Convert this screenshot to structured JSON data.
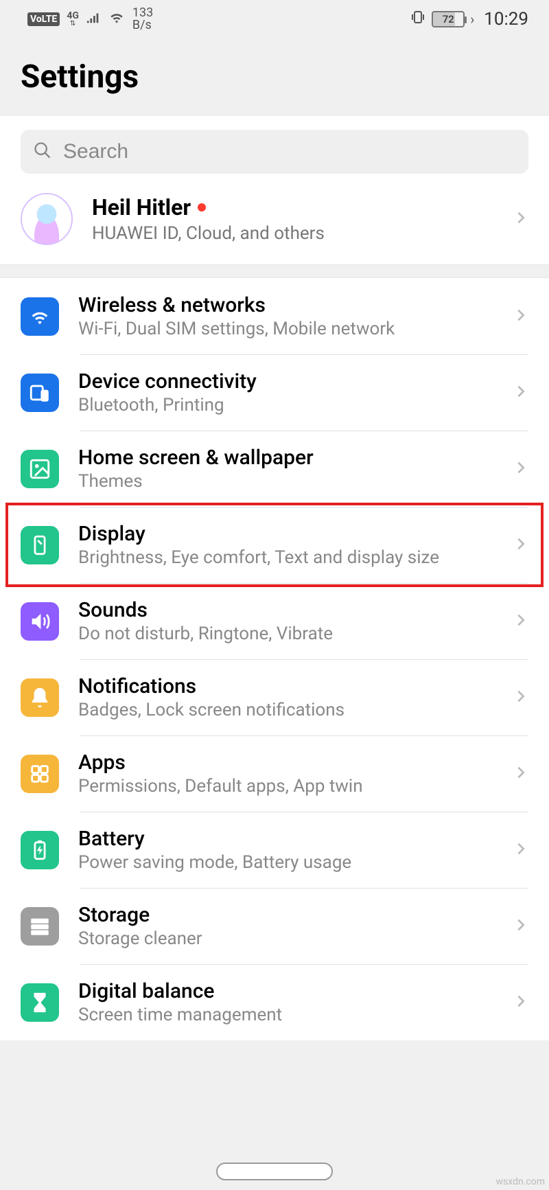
{
  "status": {
    "volte": "VoLTE",
    "network_gen": "4G",
    "speed_value": "133",
    "speed_unit": "B/s",
    "battery_percent": "72",
    "time": "10:29"
  },
  "header": {
    "title": "Settings"
  },
  "search": {
    "placeholder": "Search"
  },
  "account": {
    "name": "Heil Hitler",
    "subtitle": "HUAWEI ID, Cloud, and others"
  },
  "items": [
    {
      "icon": "wifi",
      "icon_color": "blue",
      "title": "Wireless & networks",
      "subtitle": "Wi-Fi, Dual SIM settings, Mobile network"
    },
    {
      "icon": "devices",
      "icon_color": "blue",
      "title": "Device connectivity",
      "subtitle": "Bluetooth, Printing"
    },
    {
      "icon": "picture",
      "icon_color": "green",
      "title": "Home screen & wallpaper",
      "subtitle": "Themes"
    },
    {
      "icon": "display",
      "icon_color": "green",
      "title": "Display",
      "subtitle": "Brightness, Eye comfort, Text and display size",
      "highlighted": true
    },
    {
      "icon": "sound",
      "icon_color": "purple",
      "title": "Sounds",
      "subtitle": "Do not disturb, Ringtone, Vibrate"
    },
    {
      "icon": "bell",
      "icon_color": "yellow",
      "title": "Notifications",
      "subtitle": "Badges, Lock screen notifications"
    },
    {
      "icon": "apps",
      "icon_color": "yellow",
      "title": "Apps",
      "subtitle": "Permissions, Default apps, App twin"
    },
    {
      "icon": "battery",
      "icon_color": "green",
      "title": "Battery",
      "subtitle": "Power saving mode, Battery usage"
    },
    {
      "icon": "storage",
      "icon_color": "gray",
      "title": "Storage",
      "subtitle": "Storage cleaner"
    },
    {
      "icon": "hourglass",
      "icon_color": "green",
      "title": "Digital balance",
      "subtitle": "Screen time management"
    }
  ],
  "watermark": "wsxdn.com"
}
